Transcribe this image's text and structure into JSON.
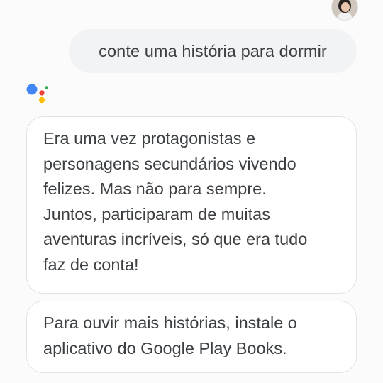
{
  "user": {
    "avatar_icon": "user-avatar-photo"
  },
  "conversation": {
    "query": "conte uma história para dormir",
    "assistant_icon": "google-assistant-dots-icon",
    "assistant_colors": [
      "#4285F4",
      "#EA4335",
      "#FBBC05",
      "#34A853"
    ],
    "story_lines": [
      "Era uma vez protagonistas e",
      "personagens secundários vivendo",
      "felizes. Mas não para sempre.",
      "Juntos, participaram de muitas",
      "aventuras incríveis, só que era tudo",
      "faz de conta!"
    ],
    "tip_lines": [
      "Para ouvir mais histórias, instale o",
      "aplicativo do Google Play Books."
    ]
  }
}
